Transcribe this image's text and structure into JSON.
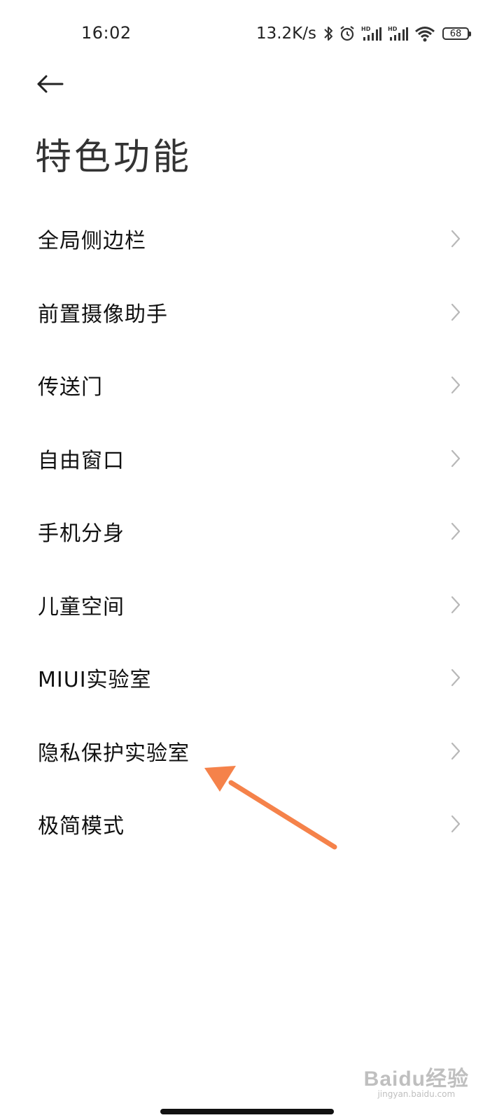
{
  "status_bar": {
    "time": "16:02",
    "net_speed": "13.2K/s",
    "battery_level": "68",
    "icons": [
      "bluetooth-icon",
      "alarm-icon",
      "hd-signal-icon",
      "hd-signal-icon",
      "wifi-icon",
      "battery-icon"
    ]
  },
  "header": {
    "back_icon": "arrow-left-icon",
    "title": "特色功能"
  },
  "list": {
    "items": [
      {
        "label": "全局侧边栏"
      },
      {
        "label": "前置摄像助手"
      },
      {
        "label": "传送门"
      },
      {
        "label": "自由窗口"
      },
      {
        "label": "手机分身"
      },
      {
        "label": "儿童空间"
      },
      {
        "label": "MIUI实验室"
      },
      {
        "label": "隐私保护实验室"
      },
      {
        "label": "极简模式"
      }
    ],
    "chevron_icon": "chevron-right-icon"
  },
  "annotation": {
    "color": "#F5824A",
    "points_to": "隐私保护实验室"
  },
  "watermark": {
    "logo": "Baidu经验",
    "url": "jingyan.baidu.com"
  }
}
